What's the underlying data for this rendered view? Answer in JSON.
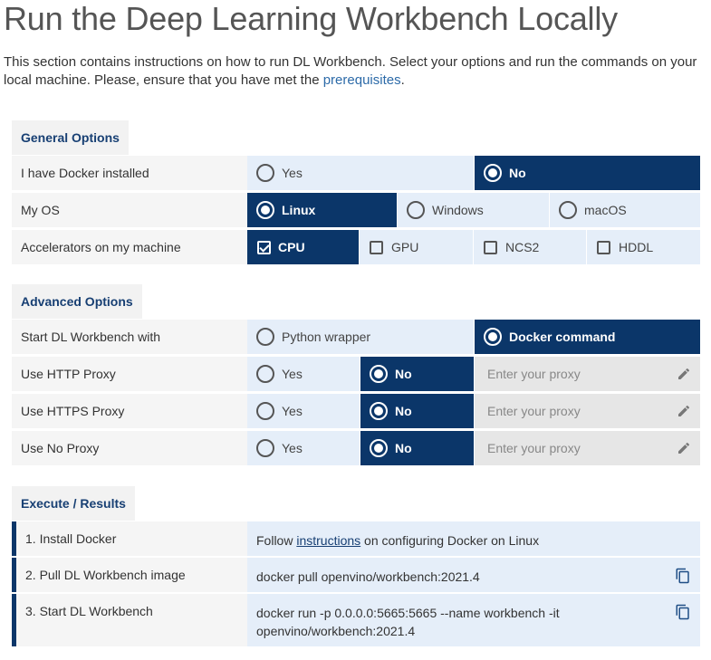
{
  "page": {
    "title": "Run the Deep Learning Workbench Locally",
    "intro_text": "This section contains instructions on how to run DL Workbench. Select your options and run the commands on your local machine. Please, ensure that you have met the ",
    "intro_link": "prerequisites",
    "intro_end": "."
  },
  "general": {
    "heading": "General Options",
    "docker": {
      "label": "I have Docker installed",
      "options": [
        "Yes",
        "No"
      ],
      "selected": "No"
    },
    "os": {
      "label": "My OS",
      "options": [
        "Linux",
        "Windows",
        "macOS"
      ],
      "selected": "Linux"
    },
    "accel": {
      "label": "Accelerators on my machine",
      "options": [
        "CPU",
        "GPU",
        "NCS2",
        "HDDL"
      ],
      "checked": [
        "CPU"
      ]
    }
  },
  "advanced": {
    "heading": "Advanced Options",
    "start": {
      "label": "Start DL Workbench with",
      "options": [
        "Python wrapper",
        "Docker command"
      ],
      "selected": "Docker command"
    },
    "http": {
      "label": "Use HTTP Proxy",
      "options": [
        "Yes",
        "No"
      ],
      "selected": "No",
      "placeholder": "Enter your proxy"
    },
    "https": {
      "label": "Use HTTPS Proxy",
      "options": [
        "Yes",
        "No"
      ],
      "selected": "No",
      "placeholder": "Enter your proxy"
    },
    "noproxy": {
      "label": "Use No Proxy",
      "options": [
        "Yes",
        "No"
      ],
      "selected": "No",
      "placeholder": "Enter your proxy"
    }
  },
  "execute": {
    "heading": "Execute / Results",
    "steps": [
      {
        "label": "1. Install Docker",
        "pre": "Follow ",
        "link": "instructions",
        "post": " on configuring Docker on Linux"
      },
      {
        "label": "2. Pull DL Workbench image",
        "command": "docker pull openvino/workbench:2021.4"
      },
      {
        "label": "3. Start DL Workbench",
        "command": "docker run -p 0.0.0.0:5665:5665 --name workbench -it openvino/workbench:2021.4"
      }
    ]
  },
  "icons": {
    "pencil": "pencil-icon",
    "copy": "copy-icon"
  },
  "colors": {
    "selected_bg": "#0b3669",
    "option_bg": "#e5eef9",
    "heading_text": "#173f73",
    "link": "#2c6aa8"
  }
}
